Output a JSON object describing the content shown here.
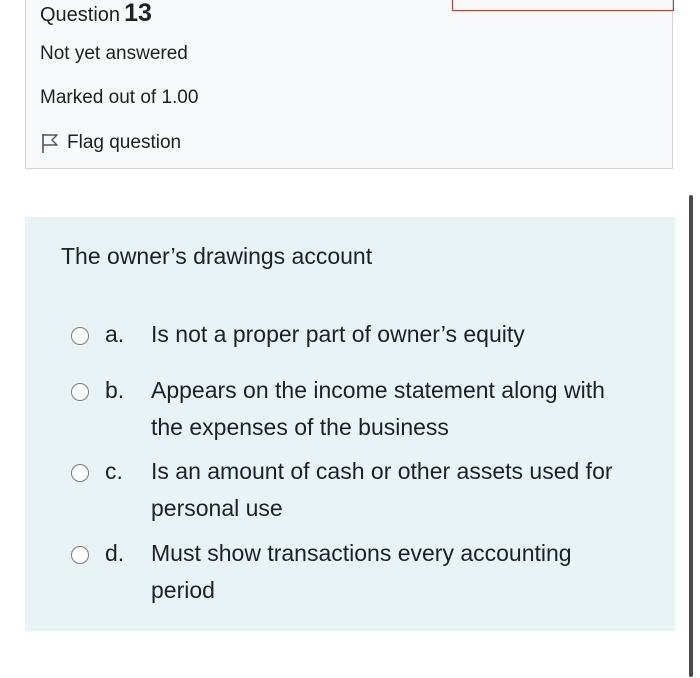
{
  "question_info": {
    "label": "Question",
    "number": "13",
    "status": "Not yet answered",
    "marks": "Marked out of 1.00",
    "flag_label": "Flag question"
  },
  "question": {
    "text": "The owner’s drawings account",
    "answers": [
      {
        "letter": "a.",
        "text": "Is not a proper part of owner’s equity"
      },
      {
        "letter": "b.",
        "text": "Appears on the income statement along with the expenses of the business"
      },
      {
        "letter": "c.",
        "text": "Is an amount of cash or other assets used for personal use"
      },
      {
        "letter": "d.",
        "text": "Must show transactions every accounting period"
      }
    ]
  },
  "icons": {
    "flag": "flag-icon",
    "radio": "radio-circle"
  },
  "colors": {
    "info_background": "#f8f9fa",
    "content_background": "#e7f3f5",
    "accent_border": "#c0392b"
  }
}
